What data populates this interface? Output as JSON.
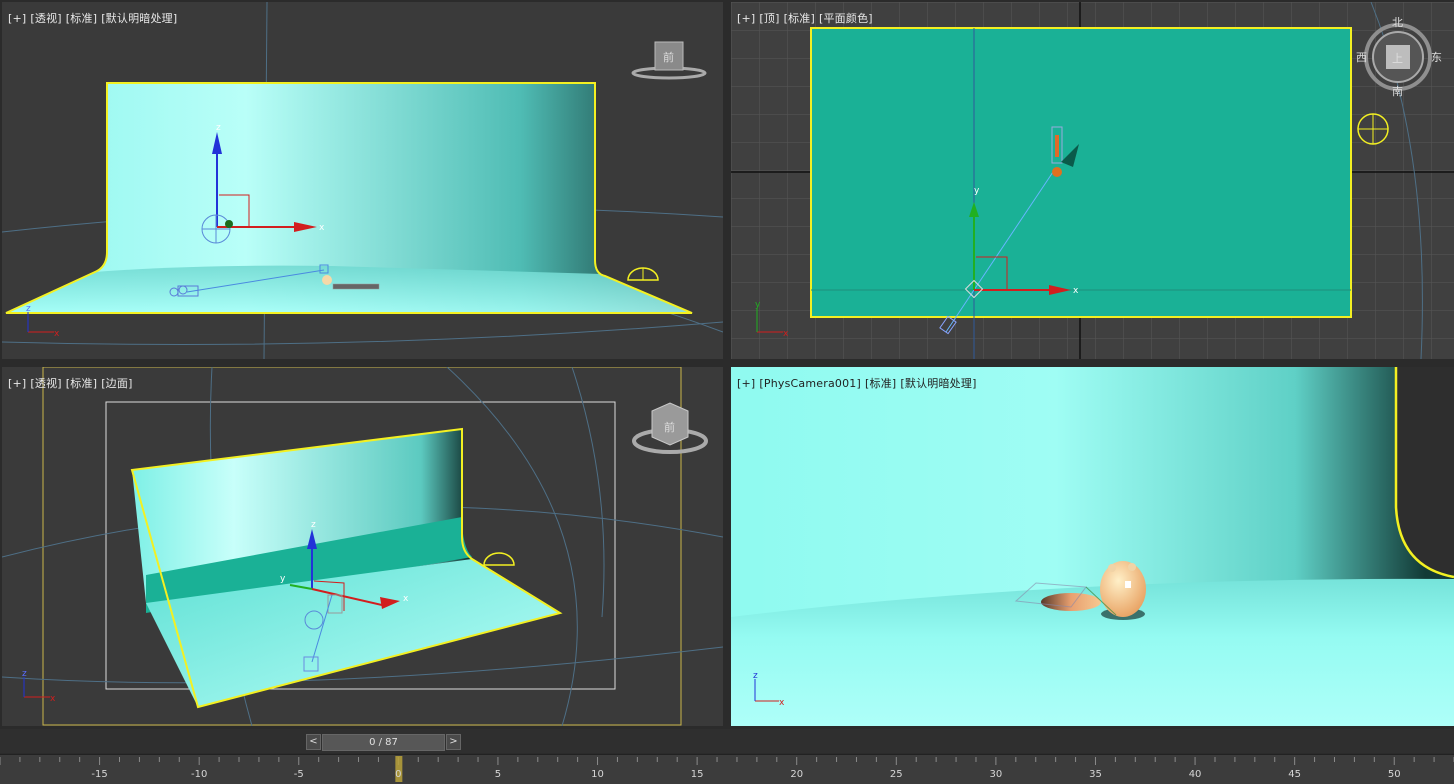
{
  "viewports": {
    "perspective": {
      "labels": [
        "[+]",
        "[透视]",
        "[标准]",
        "[默认明暗处理]"
      ],
      "viewcube_face": "前"
    },
    "top": {
      "labels": [
        "[+]",
        "[顶]",
        "[标准]",
        "[平面颜色]"
      ],
      "compass": {
        "north": "北",
        "south": "南",
        "east": "东",
        "west": "西",
        "face": "上"
      }
    },
    "front": {
      "labels": [
        "[+]",
        "[透视]",
        "[标准]",
        "[边面]"
      ],
      "viewcube_face": "前"
    },
    "camera": {
      "labels": [
        "[+]",
        "[PhysCamera001]",
        "[标准]",
        "[默认明暗处理]"
      ]
    }
  },
  "axes": {
    "x": "x",
    "y": "y",
    "z": "z"
  },
  "frame_slider": {
    "prev": "<",
    "next": ">",
    "text": "0 / 87",
    "current": 0,
    "total": 87
  },
  "timeline": {
    "ticks": [
      "-15",
      "-10",
      "-5",
      "0",
      "5",
      "10",
      "15",
      "20",
      "25",
      "30",
      "35",
      "40",
      "45",
      "50"
    ],
    "values": [
      -15,
      -10,
      -5,
      0,
      5,
      10,
      15,
      20,
      25,
      30,
      35,
      40,
      45,
      50
    ],
    "current": 0,
    "min": -20,
    "max": 53
  },
  "colors": {
    "selection": "#f3f022",
    "backdrop_top": "#1ab196",
    "grid": "#5a5a5a",
    "axis_x": "#d21e1e",
    "axis_y": "#21b021",
    "axis_z": "#2233d8",
    "viewport_active_border": "#c9b64a"
  }
}
